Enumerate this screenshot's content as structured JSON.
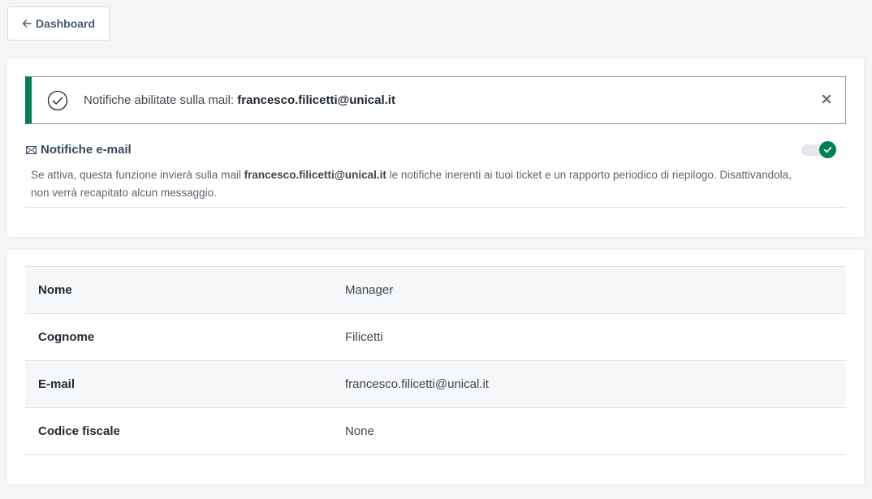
{
  "back_button": {
    "label": "Dashboard",
    "icon": "arrow-left-icon"
  },
  "alert": {
    "prefix": "Notifiche abilitate sulla mail: ",
    "email": "francesco.filicetti@unical.it",
    "icon": "check-circle-icon",
    "close_icon": "close-icon",
    "accent_color": "#008055"
  },
  "notifications": {
    "title": "Notifiche e-mail",
    "icon": "envelope-icon",
    "enabled": true,
    "toggle_color": "#008055",
    "description_before": "Se attiva, questa funzione invierà sulla mail ",
    "description_email": "francesco.filicetti@unical.it",
    "description_after": " le notifiche inerenti ai tuoi ticket e un rapporto periodico di riepilogo. Disattivandola, non verrà recapitato alcun messaggio."
  },
  "profile": {
    "rows": [
      {
        "label": "Nome",
        "value": "Manager"
      },
      {
        "label": "Cognome",
        "value": "Filicetti"
      },
      {
        "label": "E-mail",
        "value": "francesco.filicetti@unical.it"
      },
      {
        "label": "Codice fiscale",
        "value": "None"
      }
    ]
  }
}
